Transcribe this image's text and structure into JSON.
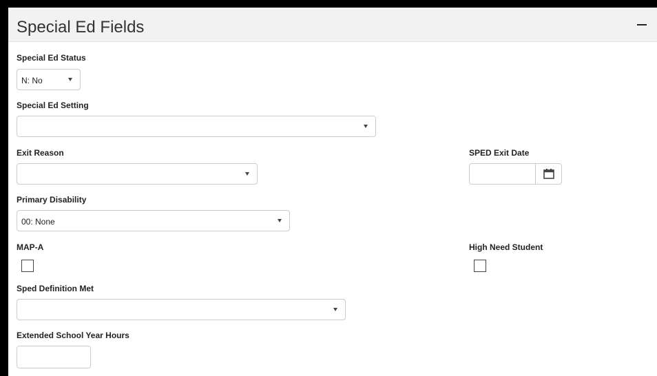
{
  "panel": {
    "title": "Special Ed Fields",
    "collapse_icon": "minus-icon"
  },
  "fields": {
    "special_ed_status": {
      "label": "Special Ed Status",
      "value": "N: No"
    },
    "special_ed_setting": {
      "label": "Special Ed Setting",
      "value": ""
    },
    "exit_reason": {
      "label": "Exit Reason",
      "value": ""
    },
    "sped_exit_date": {
      "label": "SPED Exit Date",
      "value": "",
      "icon": "calendar-icon"
    },
    "primary_disability": {
      "label": "Primary Disability",
      "value": "00: None"
    },
    "map_a": {
      "label": "MAP-A",
      "checked": false
    },
    "high_need_student": {
      "label": "High Need Student",
      "checked": false
    },
    "sped_definition_met": {
      "label": "Sped Definition Met",
      "value": ""
    },
    "extended_school_year_hours": {
      "label": "Extended School Year Hours",
      "value": ""
    }
  },
  "colors": {
    "frame": "#000000",
    "header_bg": "#f2f2f2",
    "border": "#cccccc",
    "text": "#222222"
  }
}
